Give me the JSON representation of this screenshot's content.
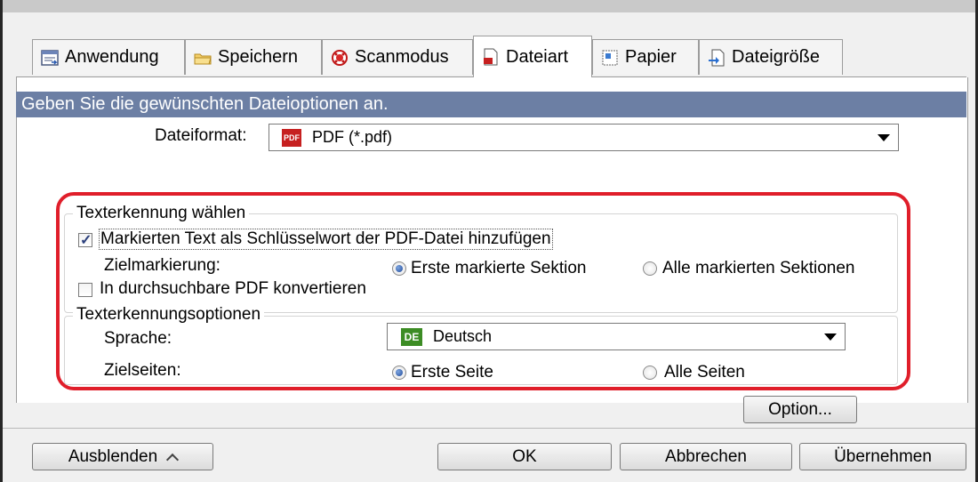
{
  "tabs": [
    {
      "label": "Anwendung",
      "icon": "application-icon",
      "active": false
    },
    {
      "label": "Speichern",
      "icon": "folder-icon",
      "active": false
    },
    {
      "label": "Scanmodus",
      "icon": "scanmode-icon",
      "active": false
    },
    {
      "label": "Dateiart",
      "icon": "document-icon",
      "active": true
    },
    {
      "label": "Papier",
      "icon": "paper-icon",
      "active": false
    },
    {
      "label": "Dateigröße",
      "icon": "filesize-icon",
      "active": false
    }
  ],
  "header": {
    "text": "Geben Sie die gewünschten Dateioptionen an."
  },
  "file_format": {
    "label": "Dateiformat:",
    "badge": "PDF",
    "value": "PDF (*.pdf)"
  },
  "text_recognition": {
    "legend": "Texterkennung wählen",
    "keyword_checkbox": {
      "label": "Markierten Text als Schlüsselwort der PDF-Datei hinzufügen",
      "checked": true
    },
    "target_label": "Zielmarkierung:",
    "radio_first": {
      "label": "Erste markierte Sektion",
      "checked": true
    },
    "radio_all": {
      "label": "Alle markierten Sektionen",
      "checked": false
    },
    "searchable_checkbox": {
      "label": "In durchsuchbare PDF konvertieren",
      "checked": false
    }
  },
  "ocr_options": {
    "legend": "Texterkennungsoptionen",
    "language_label": "Sprache:",
    "language_badge": "DE",
    "language_value": "Deutsch",
    "pages_label": "Zielseiten:",
    "radio_first_page": {
      "label": "Erste Seite",
      "checked": true
    },
    "radio_all_pages": {
      "label": "Alle Seiten",
      "checked": false
    }
  },
  "buttons": {
    "option": "Option...",
    "hide": "Ausblenden",
    "ok": "OK",
    "cancel": "Abbrechen",
    "apply": "Übernehmen"
  },
  "colors": {
    "header_bar": "#6c7fa4",
    "highlight_frame": "#e01e2a"
  }
}
